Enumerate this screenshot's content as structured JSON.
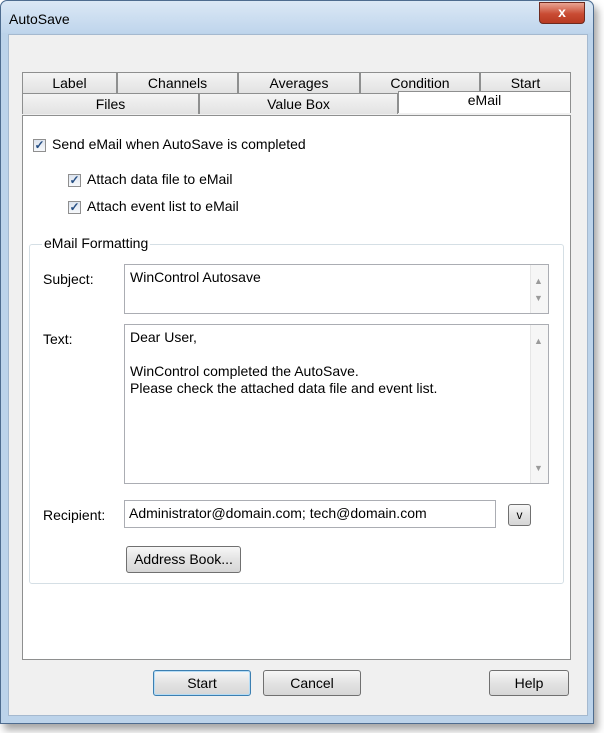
{
  "window": {
    "title": "AutoSave",
    "close_glyph": "x"
  },
  "tabs_row1": [
    "Label",
    "Channels",
    "Averages",
    "Condition",
    "Start"
  ],
  "tabs_row2": [
    "Files",
    "Value Box",
    "eMail"
  ],
  "active_tab": "eMail",
  "options": {
    "send_email": {
      "label": "Send eMail when AutoSave is completed",
      "checked": true
    },
    "attach_data": {
      "label": "Attach data file to eMail",
      "checked": true
    },
    "attach_events": {
      "label": "Attach event list to eMail",
      "checked": true
    }
  },
  "formatting": {
    "group_title": "eMail Formatting",
    "subject_label": "Subject:",
    "subject_value": "WinControl Autosave",
    "text_label": "Text:",
    "text_lines": [
      "Dear User,",
      "",
      "WinControl completed the AutoSave.",
      "Please check the attached data file and event list."
    ],
    "recipient_label": "Recipient:",
    "recipient_value": "Administrator@domain.com; tech@domain.com",
    "recipient_dropdown": "v",
    "address_book_label": "Address Book..."
  },
  "buttons": {
    "start": "Start",
    "cancel": "Cancel",
    "help": "Help"
  },
  "check_glyph": "✓",
  "icons": [
    "close-icon",
    "scroll-up-icon",
    "scroll-down-icon"
  ]
}
